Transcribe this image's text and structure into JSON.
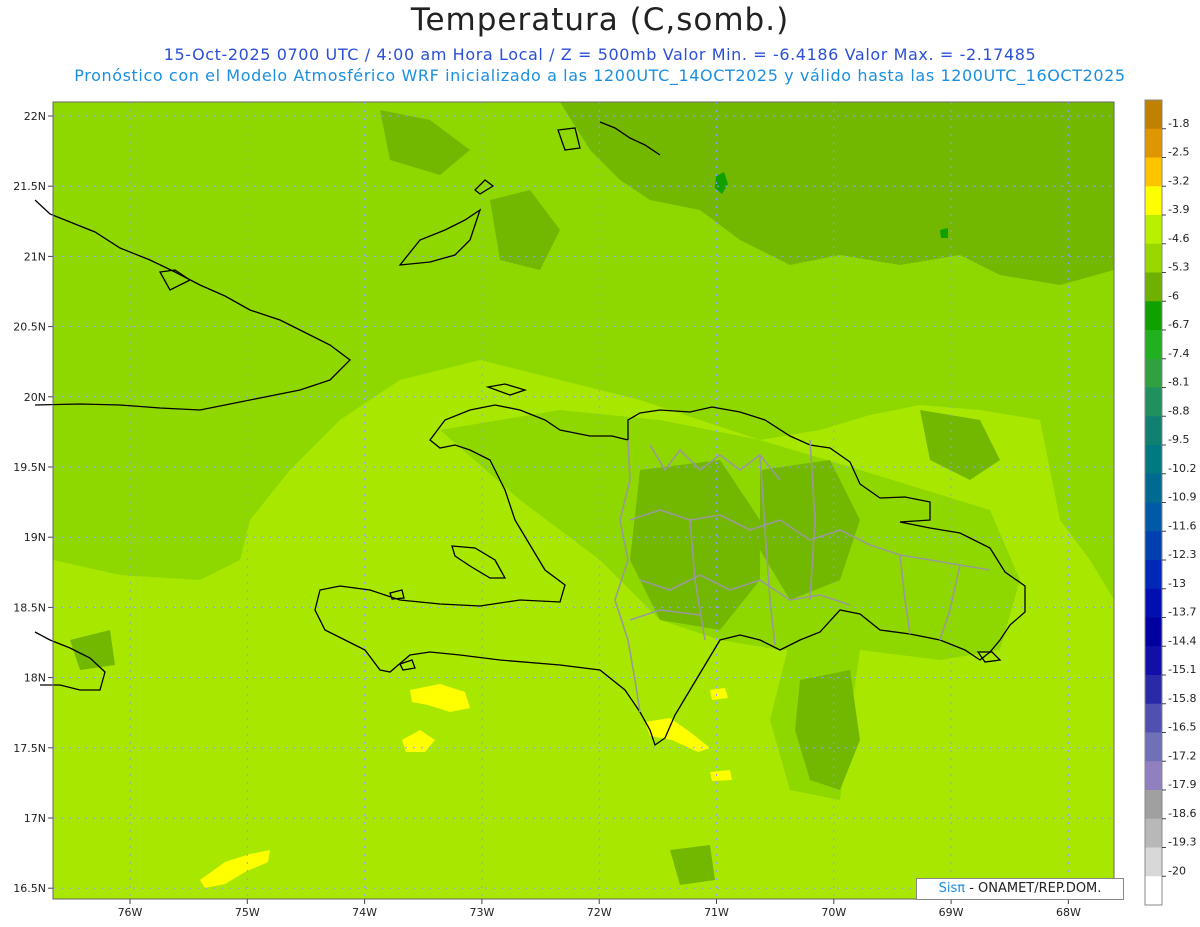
{
  "header": {
    "title": "Temperatura (C,somb.)",
    "subtitle_1": "15-Oct-2025  0700 UTC / 4:00 am Hora Local / Z = 500mb   Valor Min. = -6.4186  Valor Max. = -2.17485",
    "subtitle_2": "Pronóstico con el Modelo Atmosférico WRF inicializado a las 1200UTC_14OCT2025 y válido hasta las  1200UTC_16OCT2025"
  },
  "map": {
    "lat_labels": [
      "22N",
      "21.5N",
      "21N",
      "20.5N",
      "20N",
      "19.5N",
      "19N",
      "18.5N",
      "18N",
      "17.5N",
      "17N",
      "16.5N"
    ],
    "lon_labels": [
      "76W",
      "75W",
      "74W",
      "73W",
      "72W",
      "71W",
      "70W",
      "69W",
      "68W"
    ],
    "colors": {
      "field_base": "#a8e800",
      "field_mid": "#8ed800",
      "field_dark": "#72b800",
      "warm": "#ffff00",
      "coast": "#000000",
      "border": "#999999",
      "grid": "#9999ff"
    }
  },
  "colorbar": {
    "labels": [
      "-1.8",
      "-2.5",
      "-3.2",
      "-3.9",
      "-4.6",
      "-5.3",
      "-6",
      "-6.7",
      "-7.4",
      "-8.1",
      "-8.8",
      "-9.5",
      "-10.2",
      "-10.9",
      "-11.6",
      "-12.3",
      "-13",
      "-13.7",
      "-14.4",
      "-15.1",
      "-15.8",
      "-16.5",
      "-17.2",
      "-17.9",
      "-18.6",
      "-19.3",
      "-20"
    ],
    "colors": [
      "#c08000",
      "#e09600",
      "#ffc400",
      "#ffff00",
      "#b8f000",
      "#98d800",
      "#70b000",
      "#10a000",
      "#20b020",
      "#30a040",
      "#209060",
      "#108070",
      "#007a80",
      "#006a90",
      "#005aa8",
      "#0040b0",
      "#0028b8",
      "#0010b0",
      "#0000a0",
      "#1010a8",
      "#2a2aa8",
      "#5050b0",
      "#7070b8",
      "#9080c0",
      "#a0a0a0",
      "#b8b8b8",
      "#d8d8d8",
      "#ffffff"
    ]
  },
  "credit": {
    "brand": "Sisπ",
    "text": " - ONAMET/REP.DOM."
  }
}
